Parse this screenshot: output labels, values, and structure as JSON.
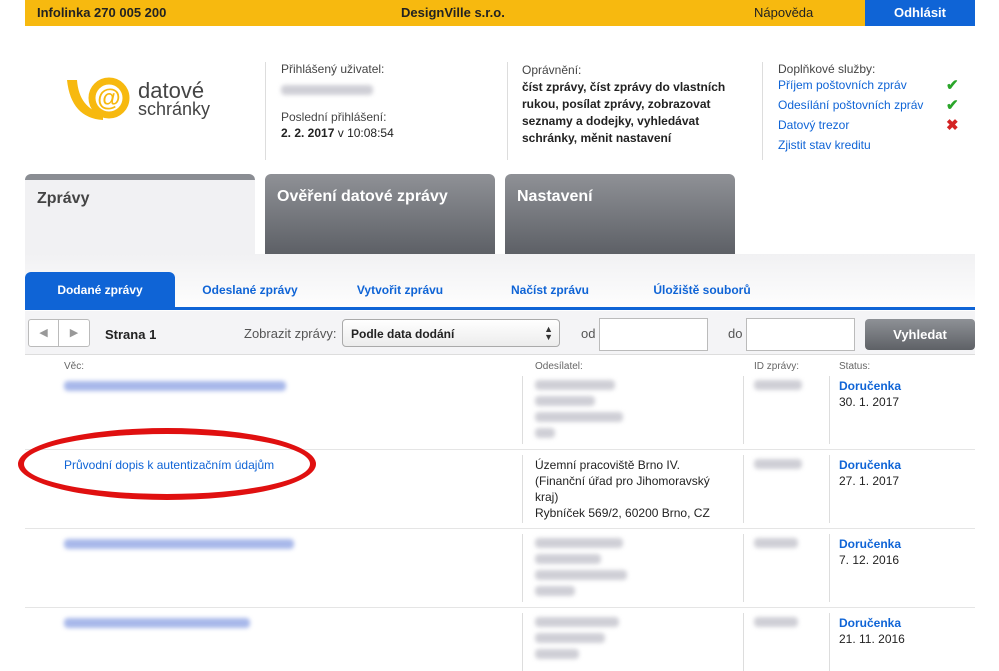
{
  "topbar": {
    "hotline": "Infolinka 270 005 200",
    "company": "DesignVille s.r.o.",
    "help": "Nápověda",
    "logout": "Odhlásit"
  },
  "logo": {
    "line1": "datové",
    "line2": "schránky"
  },
  "user": {
    "logged_label": "Přihlášený uživatel:",
    "last_login_label": "Poslední přihlášení:",
    "last_login_date": "2. 2. 2017",
    "last_login_sep": " v ",
    "last_login_time": "10:08:54"
  },
  "permissions": {
    "label": "Oprávnění:",
    "text": "číst zprávy, číst zprávy do vlastních rukou, posílat zprávy, zobrazovat seznamy a dodejky, vyhledávat schránky, měnit nastavení"
  },
  "extra_services": {
    "label": "Doplňkové služby:",
    "items": [
      {
        "label": "Příjem poštovních zpráv",
        "status": "ok",
        "mark": "✔"
      },
      {
        "label": "Odesílání poštovních zpráv",
        "status": "ok",
        "mark": "✔"
      },
      {
        "label": "Datový trezor",
        "status": "no",
        "mark": "✖"
      },
      {
        "label": "Zjistit stav kreditu",
        "status": "",
        "mark": ""
      }
    ]
  },
  "main_tabs": [
    {
      "label": "Zprávy",
      "active": true
    },
    {
      "label": "Ověření datové zprávy",
      "active": false
    },
    {
      "label": "Nastavení",
      "active": false
    }
  ],
  "sub_tabs": [
    {
      "label": "Dodané zprávy",
      "active": true
    },
    {
      "label": "Odeslané zprávy",
      "active": false
    },
    {
      "label": "Vytvořit zprávu",
      "active": false
    },
    {
      "label": "Načíst zprávu",
      "active": false
    },
    {
      "label": "Úložiště souborů",
      "active": false
    }
  ],
  "toolbar": {
    "page_label": "Strana 1",
    "show_label": "Zobrazit zprávy:",
    "show_value": "Podle data dodání",
    "from_label": "od",
    "to_label": "do",
    "from_value": "",
    "to_value": "",
    "search_label": "Vyhledat"
  },
  "table": {
    "headers": {
      "subject": "Věc:",
      "sender": "Odesílatel:",
      "id": "ID zprávy:",
      "status": "Status:"
    },
    "rows": [
      {
        "subject": "",
        "sender_lines": [],
        "status": "Doručenka",
        "date": "30. 1. 2017"
      },
      {
        "subject": "Průvodní dopis k autentizačním údajům",
        "sender_lines": [
          "Územní pracoviště Brno IV.",
          "(Finanční úřad pro Jihomoravský",
          "kraj)",
          "Rybníček 569/2, 60200 Brno, CZ"
        ],
        "status": "Doručenka",
        "date": "27. 1. 2017"
      },
      {
        "subject": "",
        "sender_lines": [],
        "status": "Doručenka",
        "date": "7. 12. 2016"
      },
      {
        "subject": "",
        "sender_lines": [],
        "status": "Doručenka",
        "date": "21. 11. 2016"
      }
    ]
  },
  "colors": {
    "accent": "#0f64d6",
    "topbar": "#f7b90f",
    "highlight": "#e01010"
  }
}
